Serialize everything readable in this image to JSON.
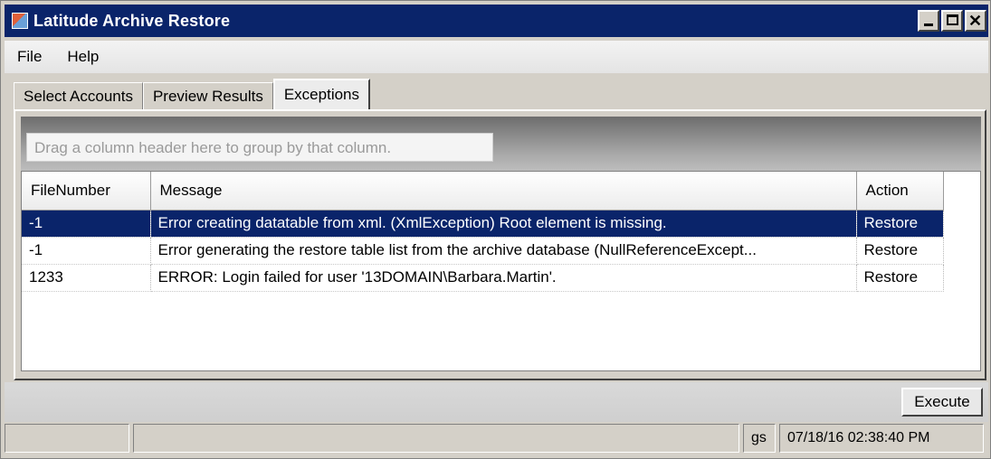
{
  "window": {
    "title": "Latitude Archive Restore"
  },
  "menu": {
    "items": [
      "File",
      "Help"
    ]
  },
  "tabs": [
    {
      "label": "Select Accounts"
    },
    {
      "label": "Preview Results"
    },
    {
      "label": "Exceptions"
    }
  ],
  "grid": {
    "group_hint": "Drag a column header here to group by that column.",
    "columns": [
      "FileNumber",
      "Message",
      "Action"
    ],
    "rows": [
      {
        "file": "-1",
        "message": "Error creating datatable from xml. (XmlException) Root element is missing.",
        "action": "Restore"
      },
      {
        "file": "-1",
        "message": "Error generating the restore table list from the archive database (NullReferenceExcept...",
        "action": "Restore"
      },
      {
        "file": "1233",
        "message": "ERROR: Login failed for user '13DOMAIN\\Barbara.Martin'.",
        "action": "Restore"
      }
    ]
  },
  "toolbar": {
    "execute_label": "Execute"
  },
  "status": {
    "user": "gs",
    "timestamp": "07/18/16 02:38:40 PM"
  },
  "colors": {
    "titlebar": "#0a246a",
    "selected_row": "#0a246a",
    "face": "#d4d0c8"
  }
}
